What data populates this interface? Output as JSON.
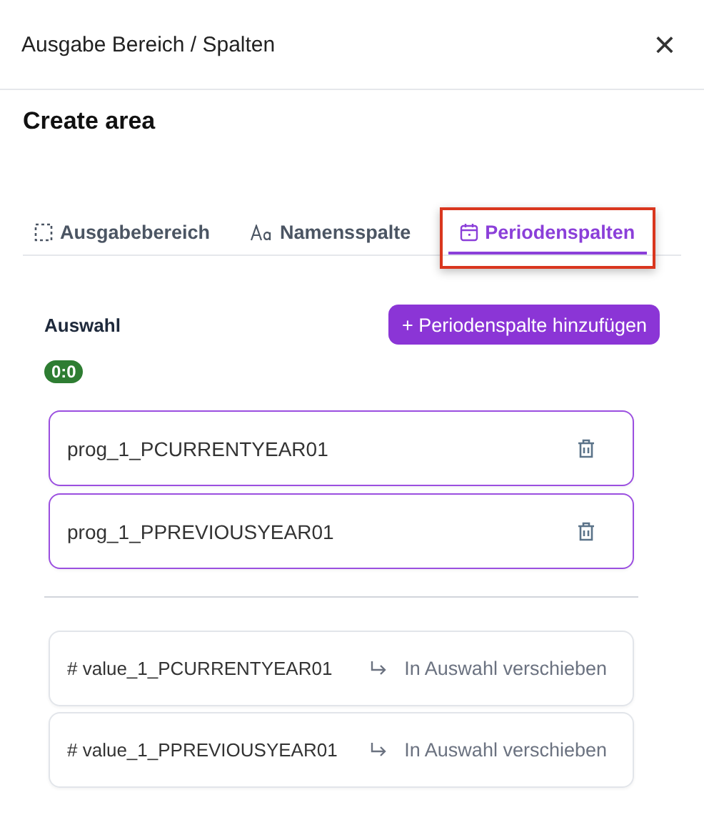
{
  "dialog": {
    "title": "Ausgabe Bereich / Spalten",
    "close": "×"
  },
  "heading": "Create area",
  "tabs": [
    {
      "label": "Ausgabebereich",
      "kind": "dashed-square",
      "selected": false,
      "highlighted": false
    },
    {
      "label": "Namensspalte",
      "kind": "text",
      "selected": false,
      "highlighted": false
    },
    {
      "label": "Periodenspalten",
      "kind": "calendar",
      "selected": true,
      "highlighted": true
    }
  ],
  "selection": {
    "label": "Auswahl",
    "count": "0:0",
    "add_button": "+ Periodenspalte hinzufügen",
    "items": [
      {
        "name": "prog_1_PCURRENTYEAR01"
      },
      {
        "name": "prog_1_PPREVIOUSYEAR01"
      }
    ]
  },
  "available": [
    {
      "name": "# value_1_PCURRENTYEAR01",
      "action": "In Auswahl verschieben"
    },
    {
      "name": "# value_1_PPREVIOUSYEAR01",
      "action": "In Auswahl verschieben"
    }
  ]
}
